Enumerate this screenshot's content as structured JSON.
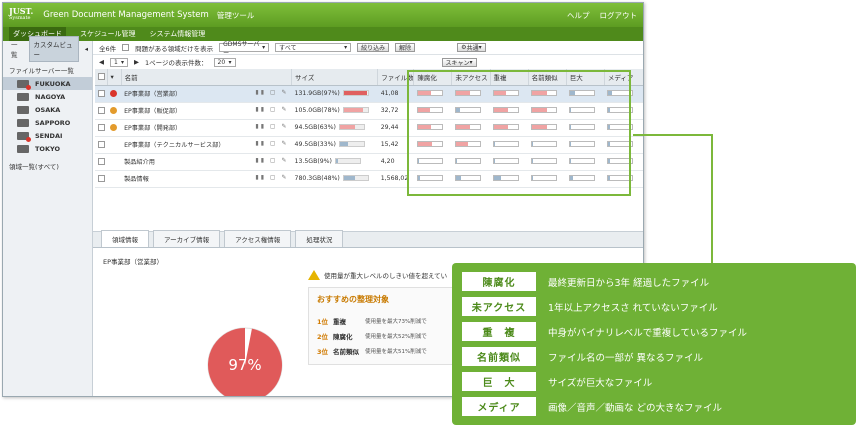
{
  "app": {
    "logo_top": "JUST.",
    "logo_sub": "Sysmate",
    "title": "Green Document Management System",
    "subtitle": "管理ツール",
    "links": [
      "ヘルプ",
      "ログアウト"
    ]
  },
  "menu": [
    "ダッシュボード",
    "スケジュール管理",
    "システム情報管理"
  ],
  "left": {
    "tabs": [
      "一覧",
      "カスタムビュー"
    ],
    "heading": "ファイルサーバー一覧",
    "servers": [
      {
        "name": "FUKUOKA",
        "alert": true,
        "selected": true
      },
      {
        "name": "NAGOYA",
        "alert": false,
        "selected": false
      },
      {
        "name": "OSAKA",
        "alert": false,
        "selected": false
      },
      {
        "name": "SAPPORO",
        "alert": false,
        "selected": false
      },
      {
        "name": "SENDAI",
        "alert": true,
        "selected": false
      },
      {
        "name": "TOKYO",
        "alert": false,
        "selected": false
      }
    ],
    "footer": "領域一覧(すべて)"
  },
  "toolbar": {
    "count": "全6件",
    "filter_label": "問題がある領域だけを表示",
    "select1": "GDMSサーバー",
    "select2": "すべて",
    "button_narrow": "絞り込み",
    "button_clear": "解除",
    "shared": "共通",
    "page": "1",
    "per_page_label": "1ページの表示件数：",
    "per_page": "20",
    "scan": "スキャン"
  },
  "table": {
    "headers": [
      "名前",
      "サイズ",
      "ファイル数",
      "陳腐化",
      "未アクセス",
      "重複",
      "名前類似",
      "巨大",
      "メディア"
    ],
    "rows": [
      {
        "name": "EP事業部（営業部）",
        "size": "131.9GB(97%)",
        "size_pct": 97,
        "files": "41,08",
        "status": "red",
        "metrics": [
          0.55,
          0.6,
          0.5,
          0.6,
          0.2,
          0.15
        ]
      },
      {
        "name": "EP事業部（販促部）",
        "size": "105.0GB(78%)",
        "size_pct": 78,
        "files": "32,72",
        "status": "orange",
        "metrics": [
          0.5,
          0.15,
          0.6,
          0.6,
          0.05,
          0.05
        ]
      },
      {
        "name": "EP事業部（開発部）",
        "size": "94.5GB(63%)",
        "size_pct": 63,
        "files": "29,44",
        "status": "orange",
        "metrics": [
          0.55,
          0.6,
          0.6,
          0.6,
          0.05,
          0.05
        ]
      },
      {
        "name": "EP事業部（テクニカルサービス部）",
        "size": "49.5GB(33%)",
        "size_pct": 33,
        "files": "15,42",
        "status": "none",
        "metrics": [
          0.6,
          0.5,
          0.05,
          0.05,
          0.05,
          0.05
        ]
      },
      {
        "name": "製品紹介用",
        "size": "13.5GB(9%)",
        "size_pct": 9,
        "files": "4,20",
        "status": "none",
        "metrics": [
          0.05,
          0.05,
          0.05,
          0.05,
          0.05,
          0.05
        ]
      },
      {
        "name": "製品情報",
        "size": "780.3GB(48%)",
        "size_pct": 48,
        "files": "1,568,02",
        "status": "none",
        "metrics": [
          0.1,
          0.2,
          0.3,
          0.05,
          0.1,
          0.05
        ]
      }
    ]
  },
  "bottom": {
    "tabs": [
      "領域情報",
      "アーカイブ情報",
      "アクセス権情報",
      "処理状況"
    ],
    "detail_label": "EP事業部（営業部）",
    "pie_value": 97,
    "pie_label": "97%",
    "warning": "使用量が重大レベルのしきい値を超えてい",
    "rec_title": "おすすめの整理対象",
    "recs": [
      {
        "rank": "1位",
        "name": "重複",
        "desc": "使用量を最大73%削減で"
      },
      {
        "rank": "2位",
        "name": "陳腐化",
        "desc": "使用量を最大52%削減で"
      },
      {
        "rank": "3位",
        "name": "名前類似",
        "desc": "使用量を最大51%削減で"
      }
    ]
  },
  "legend": [
    {
      "tag": "陳腐化",
      "desc": "最終更新日から3年 経過したファイル"
    },
    {
      "tag": "未アクセス",
      "desc": "1年以上アクセスさ れていないファイル"
    },
    {
      "tag": "重　複",
      "desc": "中身がバイナリレベルで重複しているファイル"
    },
    {
      "tag": "名前類似",
      "desc": "ファイル名の一部が 異なるファイル"
    },
    {
      "tag": "巨　大",
      "desc": "サイズが巨大なファイル"
    },
    {
      "tag": "メディア",
      "desc": "画像／音声／動画な どの大きなファイル"
    }
  ],
  "colors": {
    "accent": "#6fb136",
    "bar_red": "#e06060",
    "bar_pink": "#f0a3a3",
    "bar_blue": "#9fb7cc",
    "pie": "#e05a5a"
  }
}
